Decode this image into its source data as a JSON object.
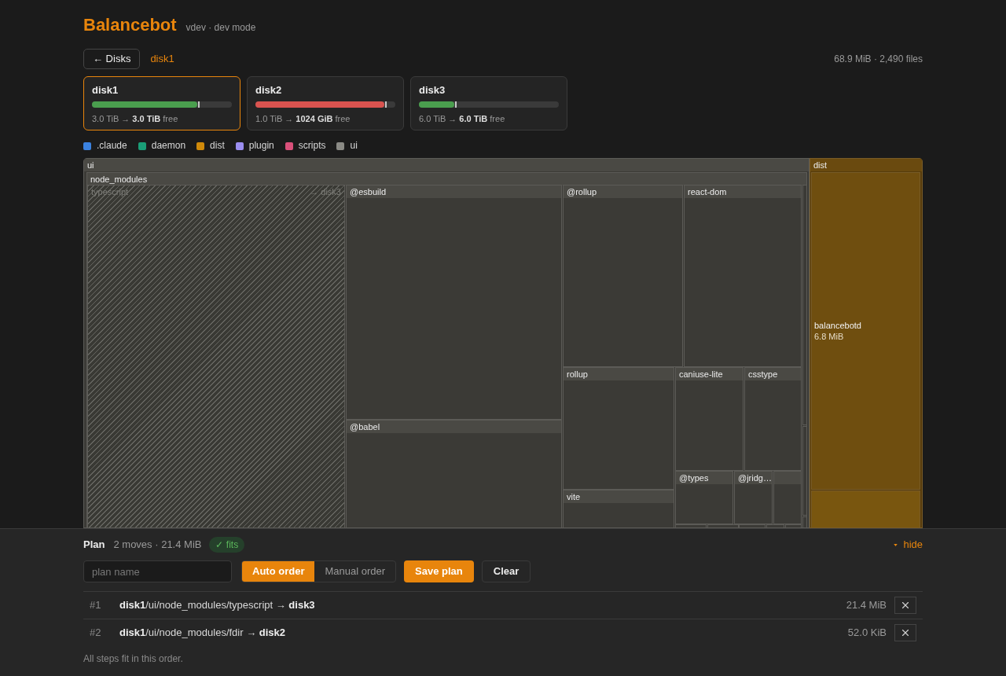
{
  "header": {
    "title": "Balancebot",
    "subtitle": "vdev · dev mode"
  },
  "nav": {
    "back": "← Disks",
    "current": "disk1",
    "summary": "68.9 MiB · 2,490 files"
  },
  "disks": [
    {
      "name": "disk1",
      "selected": true,
      "level": 0.75,
      "color": "#4a9e4e",
      "usage": "3.0 TiB → **3.0 TiB** free"
    },
    {
      "name": "disk2",
      "selected": false,
      "level": 0.92,
      "color": "#d9534f",
      "usage": "1.0 TiB → **1024 GiB** free"
    },
    {
      "name": "disk3",
      "selected": false,
      "level": 0.25,
      "color": "#4a9e4e",
      "usage": "6.0 TiB → **6.0 TiB** free"
    }
  ],
  "legend": [
    {
      "label": ".claude",
      "color": "#3b82e0"
    },
    {
      "label": "daemon",
      "color": "#1a9e77"
    },
    {
      "label": "dist",
      "color": "#d08a0a"
    },
    {
      "label": "plugin",
      "color": "#9b8ef0"
    },
    {
      "label": "scripts",
      "color": "#d9507a"
    },
    {
      "label": "ui",
      "color": "#8a8a85"
    }
  ],
  "treemap": {
    "tiles": [
      {
        "label": "ui",
        "kind": "dir",
        "color": "#4a4944",
        "children": [
          {
            "label": "node_modules",
            "kind": "dir",
            "children": [
              {
                "label": "typescript",
                "kind": "dir",
                "planned": true,
                "target": "→ disk3"
              },
              {
                "label": "@esbuild",
                "kind": "dir",
                "planned": false
              },
              {
                "label": "@babel",
                "kind": "dir",
                "planned": false
              },
              {
                "label": "@rollup",
                "kind": "dir",
                "planned": false
              },
              {
                "label": "react-dom",
                "kind": "dir",
                "planned": false
              },
              {
                "label": "rollup",
                "kind": "dir",
                "planned": false
              },
              {
                "label": "vite",
                "kind": "dir",
                "planned": false
              },
              {
                "label": "caniuse-lite",
                "kind": "dir",
                "planned": false
              },
              {
                "label": "csstype",
                "kind": "dir",
                "planned": false
              },
              {
                "label": "@types",
                "kind": "dir",
                "planned": false
              },
              {
                "label": "@jridg…",
                "kind": "dir",
                "planned": false
              }
            ]
          }
        ]
      },
      {
        "label": "dist",
        "kind": "dir",
        "color": "#6a4a0f",
        "children": [
          {
            "label": "balancebotd",
            "kind": "file",
            "planned": false,
            "size": "6.8 MiB"
          }
        ]
      }
    ]
  },
  "plan": {
    "title": "Plan",
    "summary": "2 moves · 21.4 MiB",
    "status": "✓ fits",
    "hide": "hide",
    "name_field": {
      "placeholder": "plan name"
    },
    "order_modes": [
      {
        "label": "Auto order",
        "selected": true
      },
      {
        "label": "Manual order",
        "selected": false
      }
    ],
    "save": "Save plan",
    "clear": "Clear",
    "moves": [
      {
        "index": "#1",
        "path": "**disk1**/ui/node_modules/typescript → **disk3**",
        "size": "21.4 MiB"
      },
      {
        "index": "#2",
        "path": "**disk1**/ui/node_modules/fdir → **disk2**",
        "size": "52.0 KiB"
      }
    ],
    "footer": "All steps fit in this order."
  }
}
